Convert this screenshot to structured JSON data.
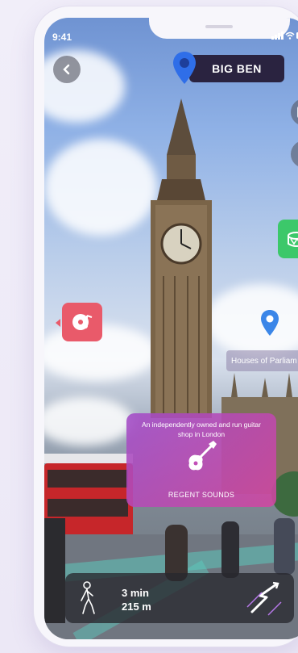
{
  "status_bar": {
    "time": "9:41",
    "icons": "•••• ▲ ▮"
  },
  "header": {
    "title": "BIG BEN",
    "back_icon": "chevron-left-icon"
  },
  "side_controls": [
    {
      "name": "gallery-icon"
    },
    {
      "name": "volume-icon"
    }
  ],
  "poi": {
    "drum": {
      "icon": "drum-icon",
      "color": "#3cc86a"
    },
    "music": {
      "icon": "music-disc-icon",
      "color": "#e95a6a"
    },
    "parliament": {
      "label": "Houses of Parliam"
    }
  },
  "shop_card": {
    "description": "An independently owned and run guitar shop in London",
    "name": "REGENT SOUNDS",
    "icon": "guitar-icon"
  },
  "navigation": {
    "time": "3 min",
    "distance": "215 m",
    "walk_icon": "walking-person-icon",
    "route_icon": "route-icon"
  }
}
